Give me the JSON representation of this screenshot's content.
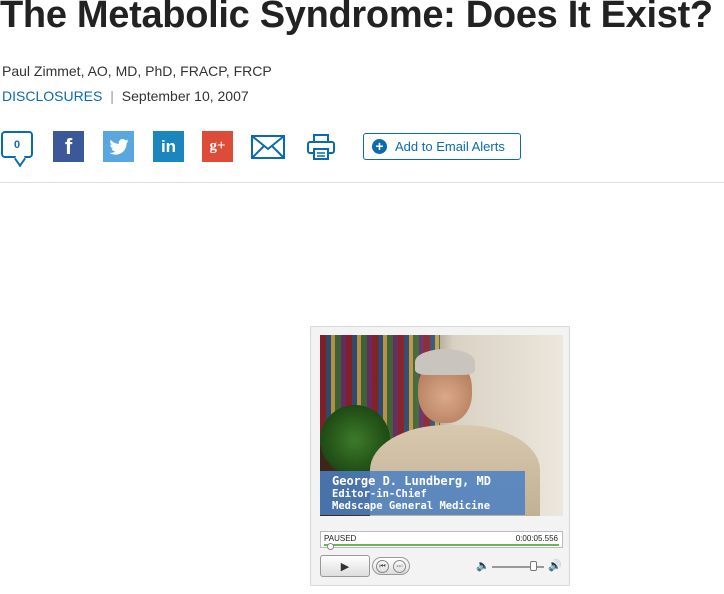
{
  "article": {
    "title": "The Metabolic Syndrome: Does It Exist?",
    "author": "Paul Zimmet, AO, MD, PhD, FRACP, FRCP",
    "disclosures_label": "DISCLOSURES",
    "separator": "|",
    "date": "September 10, 2007"
  },
  "share": {
    "comment_count": "0",
    "facebook_icon": "f",
    "twitter_icon": "twitter-bird-icon",
    "linkedin_icon": "in",
    "googleplus_icon": "g+",
    "email_icon": "envelope-icon",
    "print_icon": "printer-icon",
    "alerts_label": "Add to Email Alerts",
    "alerts_plus": "+"
  },
  "video": {
    "caption": {
      "name": "George D. Lundberg, MD",
      "role": "Editor-in-Chief",
      "org": "Medscape General Medicine"
    },
    "status": "PAUSED",
    "time": "0:00:05.556",
    "play_symbol": "▶",
    "prev_symbol": "⏮",
    "next_symbol": "⏭",
    "volume_min_symbol": "🔈",
    "volume_max_symbol": "🔊",
    "progress_fraction": 0.02,
    "volume_fraction": 0.8
  },
  "colors": {
    "link": "#0a6bb0",
    "facebook": "#3b5998",
    "twitter": "#5aa7df",
    "linkedin": "#1b86bd",
    "googleplus": "#dd4b39",
    "progress": "#6bb35a"
  }
}
